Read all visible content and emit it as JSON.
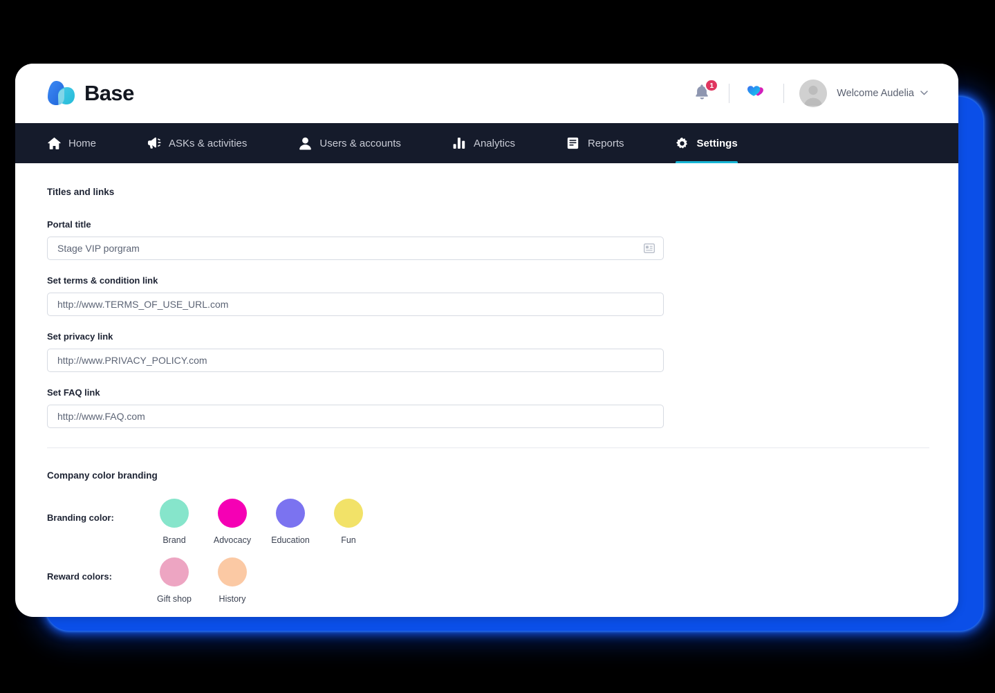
{
  "brand": {
    "name": "Base",
    "logo_icon": "base-droplets-logo",
    "logo_colors": [
      "#2D7CF0",
      "#1BBFD9"
    ]
  },
  "header": {
    "notifications": {
      "icon": "bell-icon",
      "count": "1",
      "badge_color": "#E0355F"
    },
    "hearts": {
      "icon": "двa-hearts-icon",
      "colors": [
        "#1B9CF0",
        "#E8189E"
      ]
    },
    "user": {
      "avatar_icon": "user-avatar",
      "greeting": "Welcome Audelia",
      "chevron_icon": "chevron-down-icon"
    }
  },
  "nav": {
    "items": [
      {
        "label": "Home",
        "icon": "home-icon",
        "active": false
      },
      {
        "label": "ASKs & activities",
        "icon": "megaphone-icon",
        "active": false
      },
      {
        "label": "Users & accounts",
        "icon": "person-icon",
        "active": false
      },
      {
        "label": "Analytics",
        "icon": "bar-chart-icon",
        "active": false
      },
      {
        "label": "Reports",
        "icon": "document-icon",
        "active": false
      },
      {
        "label": "Settings",
        "icon": "gear-icon",
        "active": true
      }
    ],
    "active_underline_color": "#18B6D6",
    "background_color": "#151B2B"
  },
  "content": {
    "titles_section": {
      "heading": "Titles and links",
      "fields": [
        {
          "label": "Portal title",
          "value": "Stage VIP porgram",
          "placeholder": "Portal title",
          "trailing_icon": "id-card-icon"
        },
        {
          "label": "Set terms & condition link",
          "value": "http://www.TERMS_OF_USE_URL.com",
          "placeholder": "http://www.TERMS_OF_USE_URL.com",
          "trailing_icon": ""
        },
        {
          "label": "Set privacy link",
          "value": "http://www.PRIVACY_POLICY.com",
          "placeholder": "http://www.PRIVACY_POLICY.com",
          "trailing_icon": ""
        },
        {
          "label": "Set FAQ link",
          "value": "http://www.FAQ.com",
          "placeholder": "http://www.FAQ.com",
          "trailing_icon": ""
        }
      ]
    },
    "branding_section": {
      "heading": "Company color branding",
      "branding_row": {
        "label": "Branding color:",
        "swatches": [
          {
            "name": "Brand",
            "color": "#86E5CB"
          },
          {
            "name": "Advocacy",
            "color": "#F500B4"
          },
          {
            "name": "Education",
            "color": "#7B73F0"
          },
          {
            "name": "Fun",
            "color": "#F2E268"
          }
        ]
      },
      "reward_row": {
        "label": "Reward colors:",
        "swatches": [
          {
            "name": "Gift shop",
            "color": "#EDA5C2"
          },
          {
            "name": "History",
            "color": "#FBC9A4"
          }
        ]
      }
    }
  }
}
